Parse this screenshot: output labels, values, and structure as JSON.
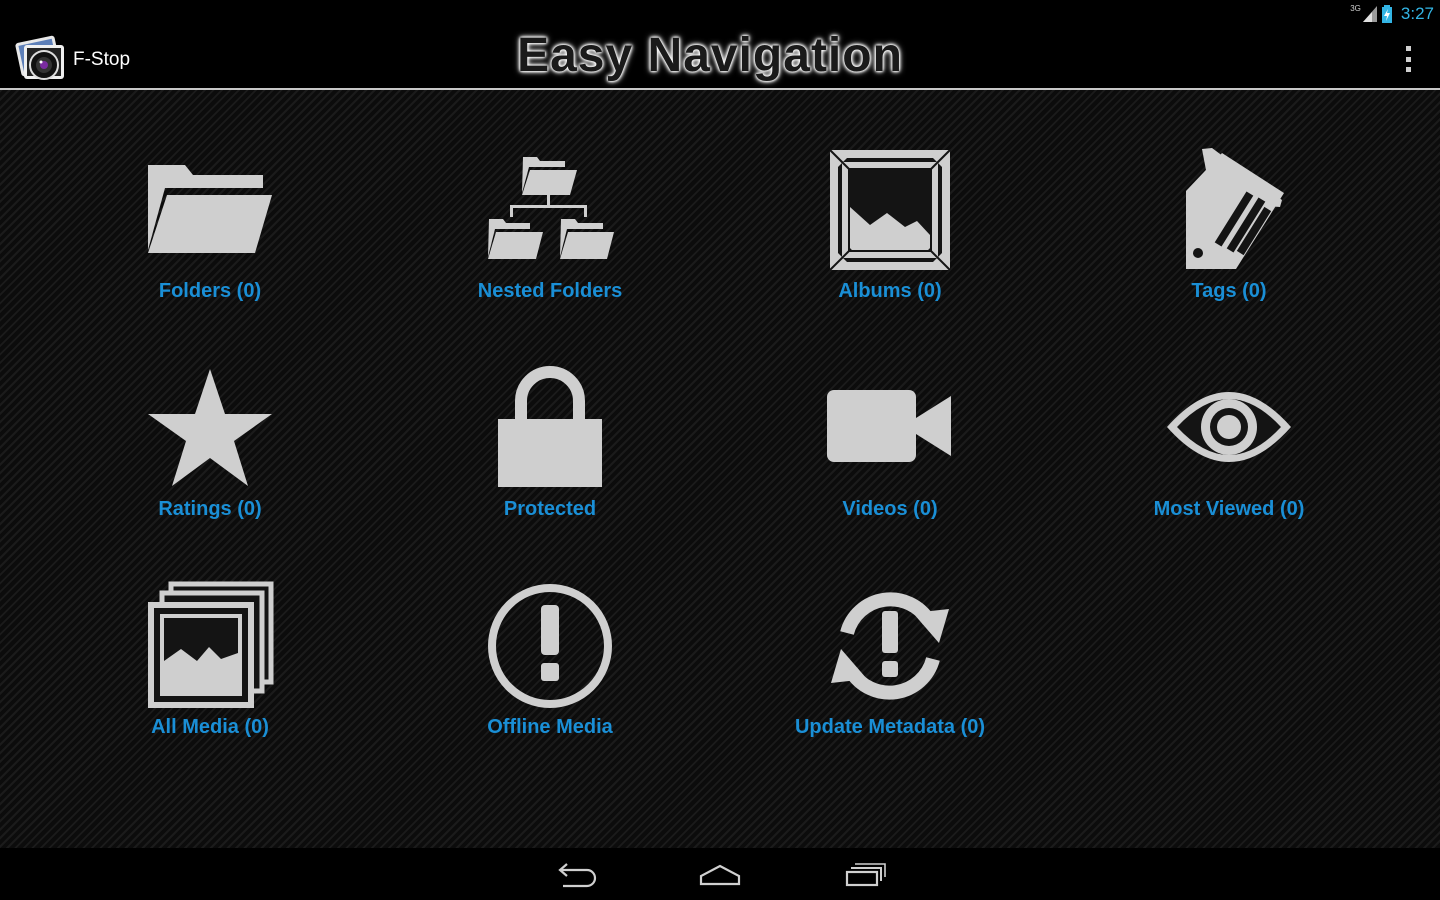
{
  "status": {
    "network": "3G",
    "time": "3:27",
    "icons": [
      "signal-icon",
      "battery-charging-icon"
    ]
  },
  "actionbar": {
    "app_name": "F-Stop",
    "heading": "Easy Navigation",
    "icons": [
      "app-camera-icon",
      "overflow-menu-icon"
    ]
  },
  "tiles": [
    {
      "label": "Folders (0)",
      "icon": "folder-icon"
    },
    {
      "label": "Nested Folders",
      "icon": "nested-folders-icon"
    },
    {
      "label": "Albums (0)",
      "icon": "album-icon"
    },
    {
      "label": "Tags (0)",
      "icon": "tag-icon"
    },
    {
      "label": "Ratings (0)",
      "icon": "star-icon"
    },
    {
      "label": "Protected",
      "icon": "lock-icon"
    },
    {
      "label": "Videos (0)",
      "icon": "video-camera-icon"
    },
    {
      "label": "Most Viewed (0)",
      "icon": "eye-icon"
    },
    {
      "label": "All Media (0)",
      "icon": "media-stack-icon"
    },
    {
      "label": "Offline Media",
      "icon": "exclamation-circle-icon"
    },
    {
      "label": "Update Metadata (0)",
      "icon": "refresh-alert-icon"
    }
  ],
  "navbar": {
    "buttons": [
      "back-icon",
      "home-icon",
      "recent-apps-icon"
    ]
  },
  "colors": {
    "accent": "#1a8fd6",
    "icon_fill": "#cfcfcf",
    "status_blue": "#33b5e5"
  }
}
